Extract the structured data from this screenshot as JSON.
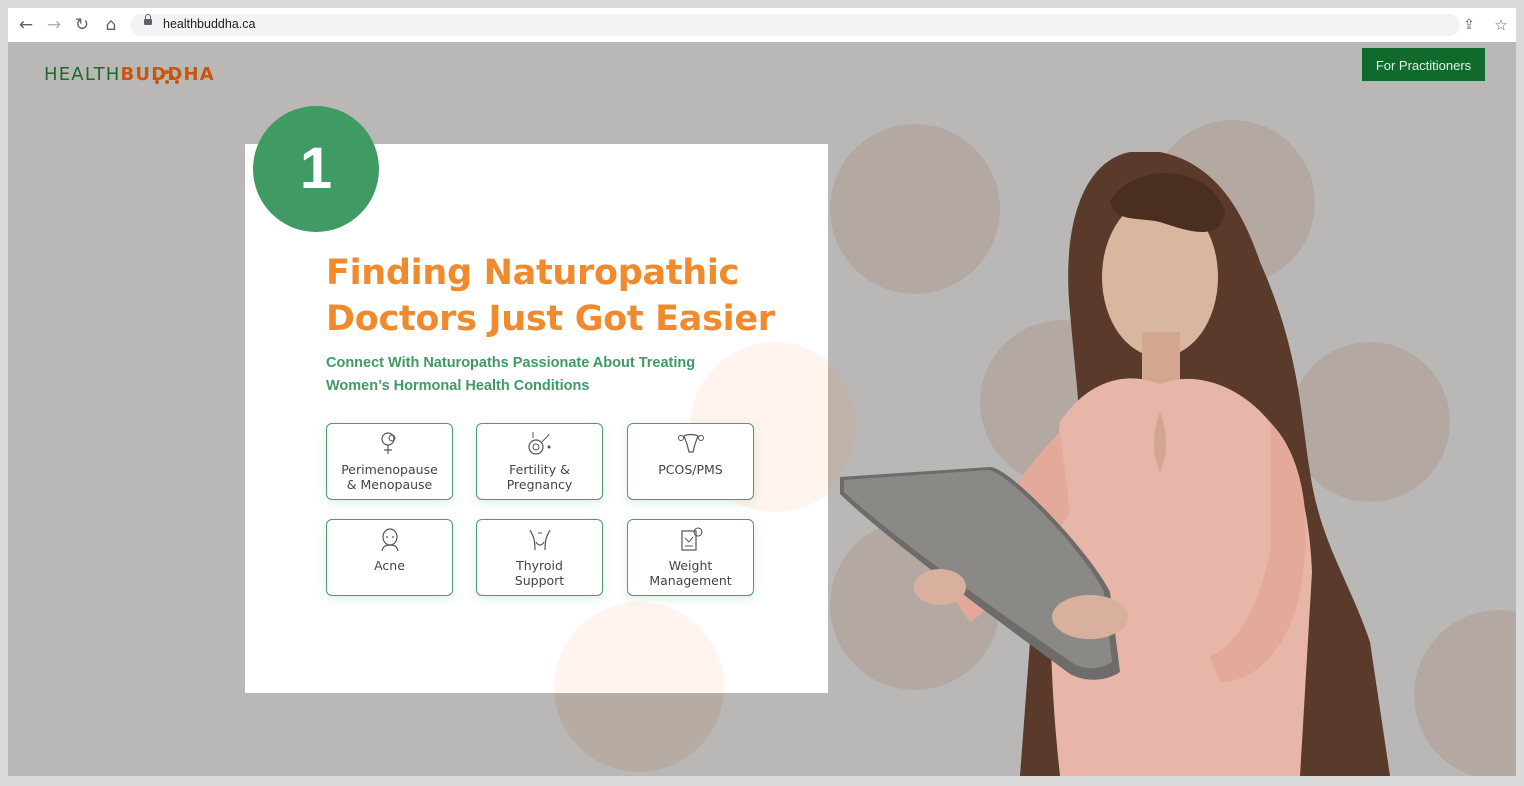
{
  "browser": {
    "url": "healthbuddha.ca",
    "back_icon": "arrow-left-icon",
    "forward_icon": "arrow-right-icon",
    "reload_icon": "reload-icon",
    "home_icon": "home-icon",
    "share_icon": "share-icon",
    "bookmark_icon": "star-icon"
  },
  "header": {
    "logo_part1": "HEALTH",
    "logo_part2": "BUDDHA",
    "practitioners_label": "For Practitioners"
  },
  "hero": {
    "step_number": "1",
    "headline_line1": "Finding Naturopathic",
    "headline_line2": "Doctors Just Got Easier",
    "subhead_line1": "Connect With Naturopaths Passionate About Treating",
    "subhead_line2": "Women’s Hormonal Health Conditions"
  },
  "conditions": [
    {
      "line1": "Perimenopause",
      "line2": "& Menopause",
      "icon": "female-symbol-moon-icon"
    },
    {
      "line1": "Fertility &",
      "line2": "Pregnancy",
      "icon": "sperm-egg-icon"
    },
    {
      "line1": "PCOS/PMS",
      "line2": "",
      "icon": "uterus-icon"
    },
    {
      "line1": "Acne",
      "line2": "",
      "icon": "face-icon"
    },
    {
      "line1": "Thyroid",
      "line2": "Support",
      "icon": "thyroid-neck-icon"
    },
    {
      "line1": "Weight",
      "line2": "Management",
      "icon": "scale-chart-icon"
    }
  ],
  "colors": {
    "brand_green": "#0f6a2b",
    "accent_orange": "#f08a2c",
    "badge_green": "#3f9a64",
    "overlay_gray": "#b9b8b7"
  }
}
